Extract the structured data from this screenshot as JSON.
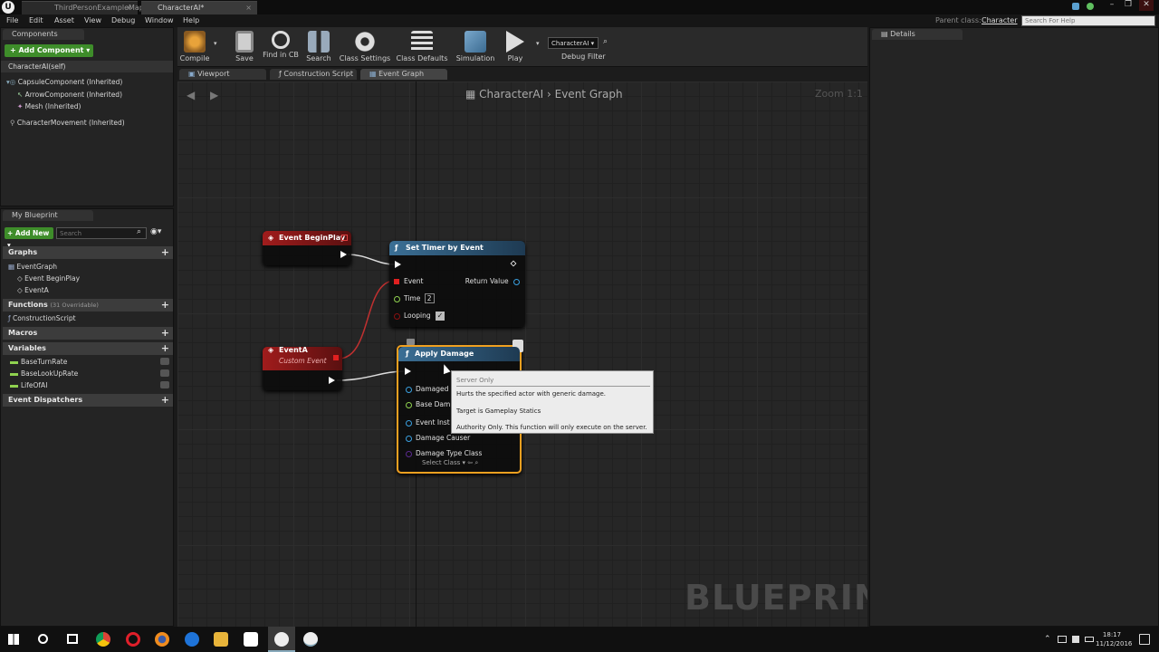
{
  "titlebar": {
    "tabs": [
      {
        "label": "ThirdPersonExampleMap"
      },
      {
        "label": "CharacterAI*"
      }
    ],
    "window_controls": [
      "–",
      "❐",
      "✕"
    ]
  },
  "menubar": {
    "items": [
      "File",
      "Edit",
      "Asset",
      "View",
      "Debug",
      "Window",
      "Help"
    ],
    "parent_class_label": "Parent class:",
    "parent_class_value": "Character",
    "help_search_placeholder": "Search For Help"
  },
  "components": {
    "tab": "Components",
    "add_button": "+ Add Component ▾",
    "self": "CharacterAI(self)",
    "items": [
      "CapsuleComponent (Inherited)",
      "ArrowComponent (Inherited)",
      "Mesh (Inherited)",
      "CharacterMovement (Inherited)"
    ]
  },
  "my_blueprint": {
    "tab": "My Blueprint",
    "add_new": "+ Add New ▾",
    "search_placeholder": "Search",
    "graphs_header": "Graphs",
    "graph_items": [
      "EventGraph",
      "Event BeginPlay",
      "EventA"
    ],
    "functions_header": "Functions",
    "functions_count": "(31 Overridable)",
    "function_items": [
      "ConstructionScript"
    ],
    "macros_header": "Macros",
    "variables_header": "Variables",
    "variable_items": [
      "BaseTurnRate",
      "BaseLookUpRate",
      "LifeOfAI"
    ],
    "dispatchers_header": "Event Dispatchers"
  },
  "toolbar": {
    "buttons": [
      "Compile",
      "Save",
      "Find in CB",
      "Search",
      "Class Settings",
      "Class Defaults",
      "Simulation",
      "Play"
    ],
    "debug_select": "CharacterAI ▾",
    "debug_filter": "Debug Filter"
  },
  "editor_tabs": [
    "Viewport",
    "Construction Script",
    "Event Graph"
  ],
  "graph": {
    "breadcrumb_class": "CharacterAI",
    "breadcrumb_sep": "›",
    "breadcrumb_graph": "Event Graph",
    "zoom": "Zoom 1:1",
    "watermark": "BLUEPRINT",
    "nodes": {
      "begin_play": {
        "title": "Event BeginPlay"
      },
      "set_timer": {
        "title": "Set Timer by Event",
        "event_pin": "Event",
        "return_pin": "Return Value",
        "time_pin": "Time",
        "time_value": "2",
        "looping_pin": "Looping"
      },
      "event_a": {
        "title": "EventA",
        "subtitle": "Custom Event"
      },
      "apply_damage": {
        "title": "Apply Damage",
        "pins": [
          "Damaged",
          "Base Dam",
          "Event Inst",
          "Damage Causer",
          "Damage Type Class"
        ],
        "select_class": "Select Class ▾"
      }
    }
  },
  "tooltip": {
    "header": "Server Only",
    "line1": "Hurts the specified actor with generic damage.",
    "line2": "Target is Gameplay Statics",
    "line3": "Authority Only. This function will only execute on the server."
  },
  "details": {
    "tab": "Details"
  },
  "taskbar": {
    "time": "18:17",
    "date": "11/12/2016"
  },
  "colors": {
    "accent_green": "#3e8d2a",
    "event_red": "#8a1616",
    "function_blue": "#2f5d80",
    "selected_orange": "#f0a020"
  }
}
